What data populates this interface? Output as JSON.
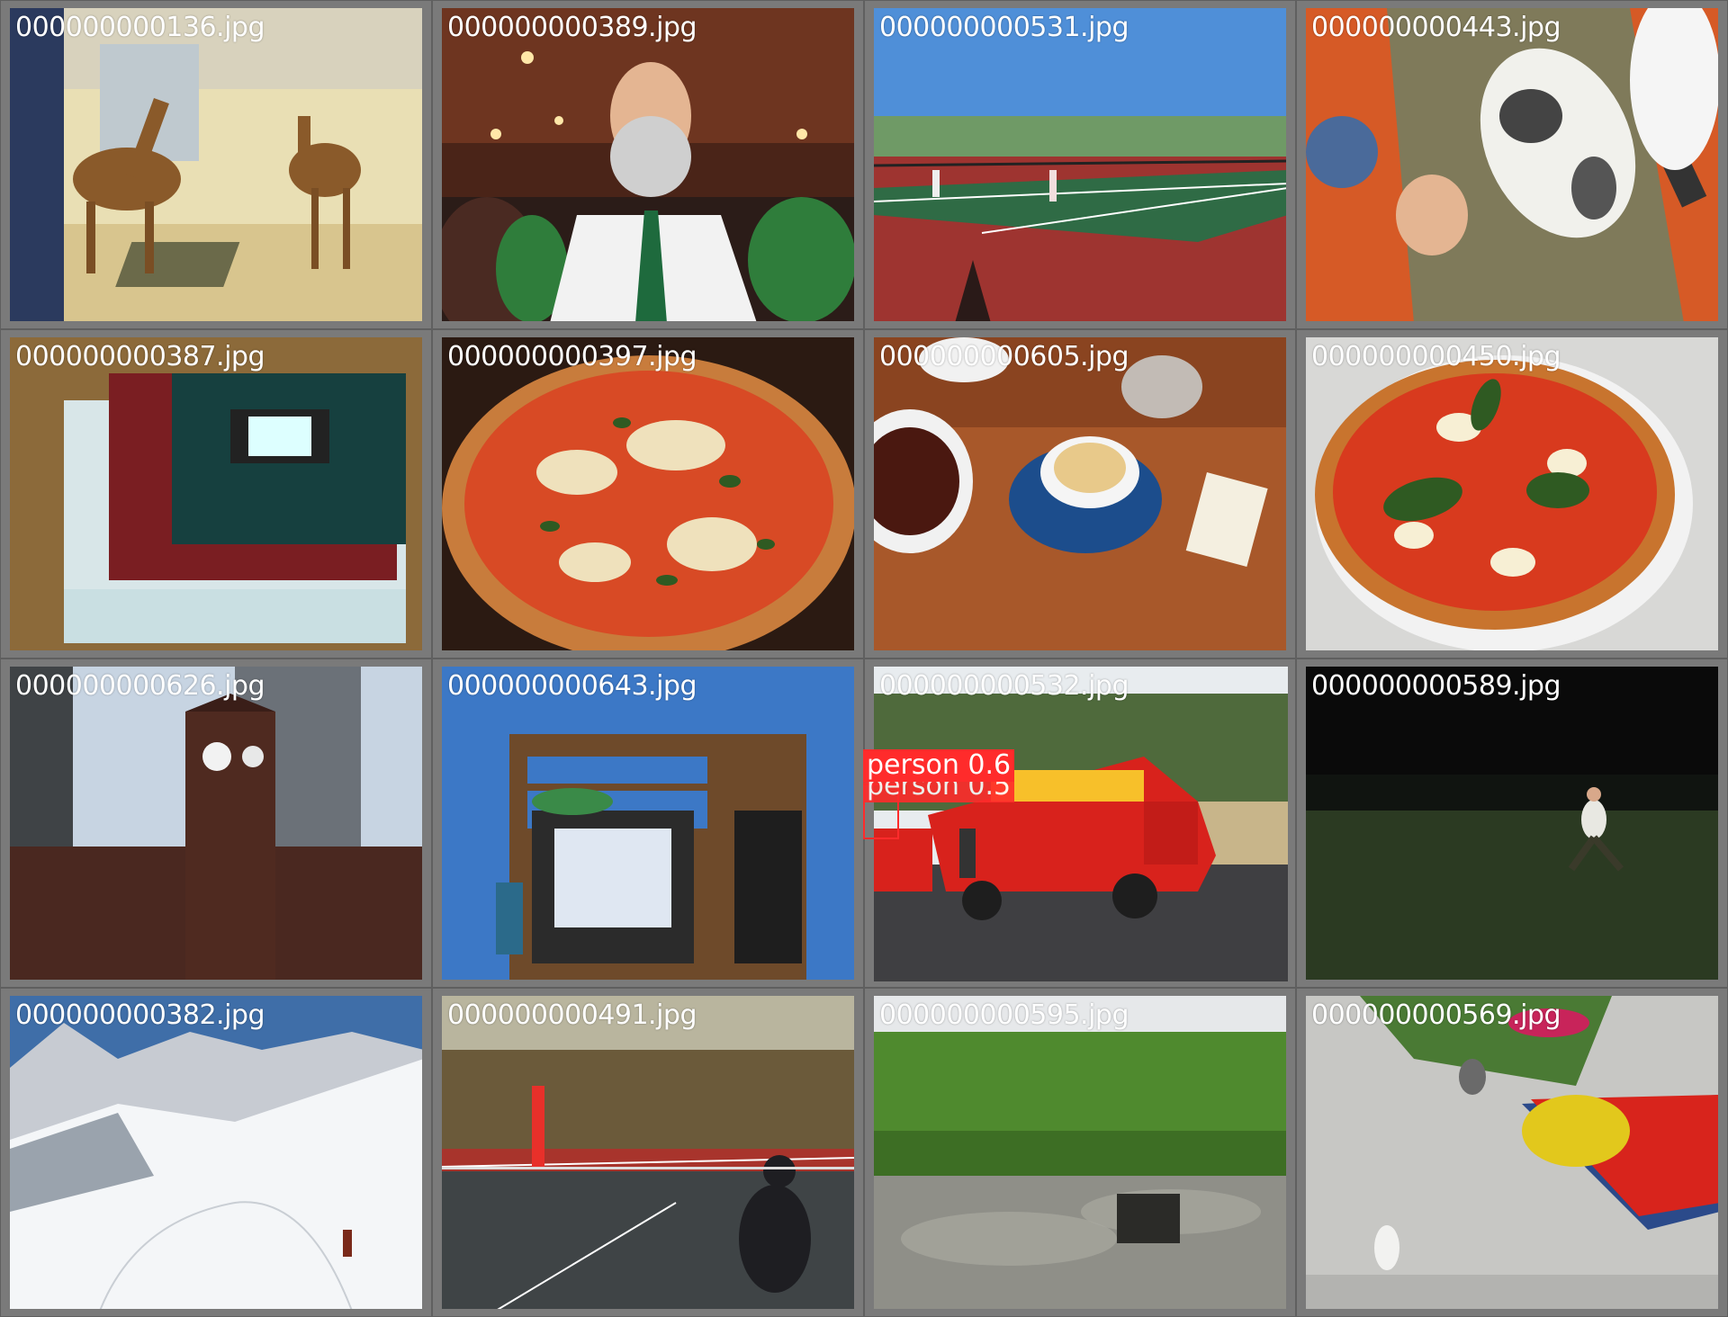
{
  "images": [
    {
      "filename": "000000000136.jpg"
    },
    {
      "filename": "000000000389.jpg"
    },
    {
      "filename": "000000000531.jpg"
    },
    {
      "filename": "000000000443.jpg"
    },
    {
      "filename": "000000000387.jpg"
    },
    {
      "filename": "000000000397.jpg"
    },
    {
      "filename": "000000000605.jpg"
    },
    {
      "filename": "000000000450.jpg"
    },
    {
      "filename": "000000000626.jpg"
    },
    {
      "filename": "000000000643.jpg"
    },
    {
      "filename": "000000000532.jpg"
    },
    {
      "filename": "000000000589.jpg"
    },
    {
      "filename": "000000000382.jpg"
    },
    {
      "filename": "000000000491.jpg"
    },
    {
      "filename": "000000000595.jpg"
    },
    {
      "filename": "000000000569.jpg"
    }
  ],
  "detections": [
    {
      "label": "person 0.6"
    },
    {
      "label": "person 0.5"
    }
  ],
  "colors": {
    "detection": "#ff2b2b",
    "border": "#8a8a8a"
  }
}
